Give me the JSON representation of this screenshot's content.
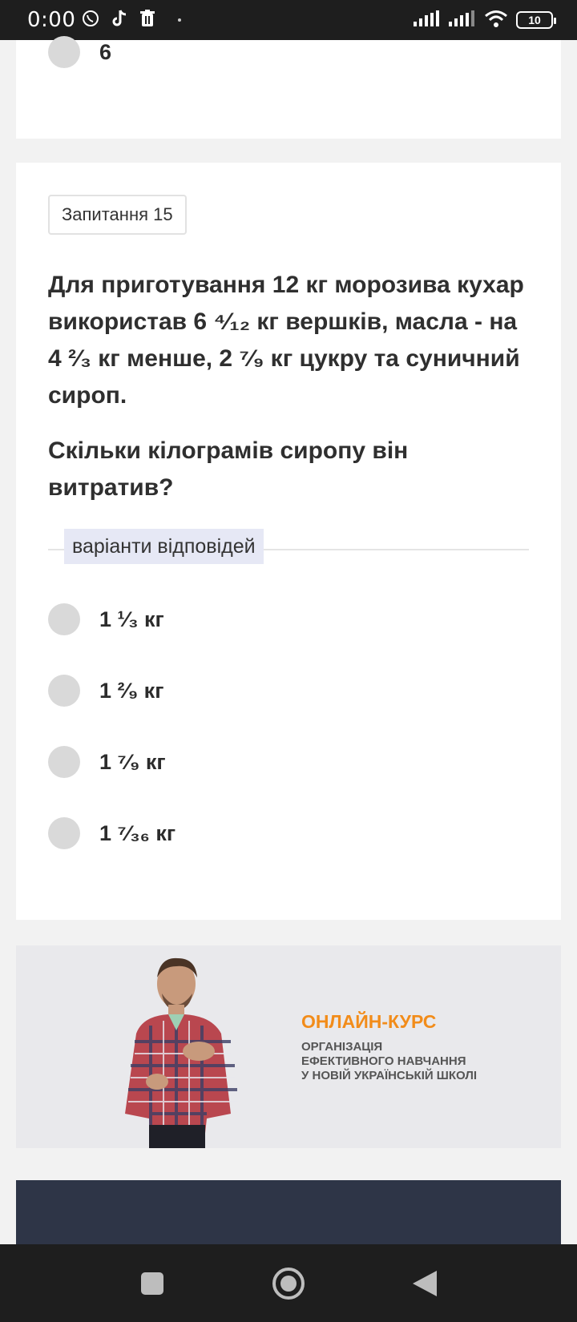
{
  "status_bar": {
    "time": "0:00",
    "battery": "10",
    "icons": [
      "viber-icon",
      "tiktok-icon",
      "trash-icon",
      "signal-icon",
      "wifi-icon",
      "battery-icon"
    ]
  },
  "prev_question": {
    "last_option": "6"
  },
  "question": {
    "badge": "Запитання 15",
    "text": "Для приготування 12 кг морозива кухар використав 6 ⁴⁄₁₂ кг вершків, масла - на 4 ²⁄₃ кг менше, 2 ⁷⁄₉ кг цукру та суничний сироп.",
    "ask": "Скільки кілограмів сиропу він витратив?",
    "variants_label": "варіанти відповідей",
    "options": [
      "1 ¹⁄₃ кг",
      "1 ²⁄₉ кг",
      "1 ⁷⁄₉ кг",
      "1 ⁷⁄₃₆ кг"
    ]
  },
  "banner": {
    "title": "ОНЛАЙН-КУРС",
    "line1": "ОРГАНІЗАЦІЯ",
    "line2": "ЕФЕКТИВНОГО НАВЧАННЯ",
    "line3": "У НОВІЙ УКРАЇНСЬКІЙ ШКОЛІ"
  },
  "colors": {
    "accent_orange": "#f28c1a",
    "dark_block": "#2e3547",
    "variants_bg": "#e6e8f5"
  }
}
